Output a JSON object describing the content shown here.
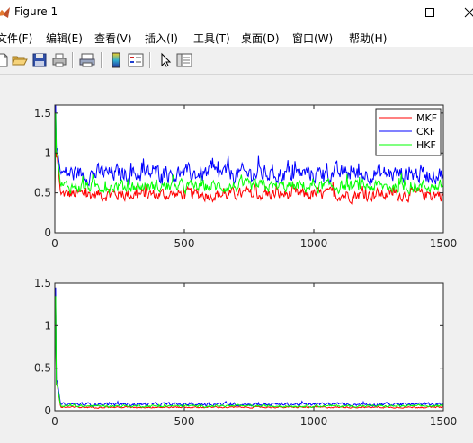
{
  "window": {
    "title": "Figure 1"
  },
  "menu": [
    {
      "label": "文件(F)"
    },
    {
      "label": "编辑(E)"
    },
    {
      "label": "查看(V)"
    },
    {
      "label": "插入(I)"
    },
    {
      "label": "工具(T)"
    },
    {
      "label": "桌面(D)"
    },
    {
      "label": "窗口(W)"
    },
    {
      "label": "帮助(H)"
    }
  ],
  "toolbar": {
    "icons": [
      "new-figure-icon",
      "open-file-icon",
      "save-icon",
      "print-icon",
      "print-preview-icon",
      "colorbar-icon",
      "legend-icon",
      "edit-plot-arrow-icon",
      "property-editor-icon"
    ]
  },
  "colors": {
    "MKF": "#ff0000",
    "CKF": "#0000ff",
    "HKF": "#00ff00"
  },
  "chart_data": [
    {
      "type": "line",
      "title": "",
      "xlabel": "",
      "ylabel": "",
      "xlim": [
        0,
        1500
      ],
      "ylim": [
        0,
        1.6
      ],
      "xticks": [
        0,
        500,
        1000,
        1500
      ],
      "yticks": [
        0,
        0.5,
        1,
        1.5
      ],
      "legend": "top-right",
      "series": [
        {
          "name": "MKF",
          "color": "#ff0000",
          "start": 1.2,
          "peak": 0.95,
          "level": 0.48,
          "noise": 0.05
        },
        {
          "name": "CKF",
          "color": "#0000ff",
          "start": 1.6,
          "peak": 1.05,
          "level": 0.74,
          "noise": 0.07
        },
        {
          "name": "HKF",
          "color": "#00ff00",
          "start": 1.5,
          "peak": 1.0,
          "level": 0.58,
          "noise": 0.05
        }
      ]
    },
    {
      "type": "line",
      "title": "",
      "xlabel": "",
      "ylabel": "",
      "xlim": [
        0,
        1500
      ],
      "ylim": [
        0,
        1.5
      ],
      "xticks": [
        0,
        500,
        1000,
        1500
      ],
      "yticks": [
        0,
        0.5,
        1,
        1.5
      ],
      "legend": "none",
      "series": [
        {
          "color": "#ff0000",
          "start": 1.35,
          "peak": 0.3,
          "level": 0.04,
          "noise": 0.005
        },
        {
          "color": "#0000ff",
          "start": 1.45,
          "peak": 0.35,
          "level": 0.075,
          "noise": 0.012
        },
        {
          "color": "#00ff00",
          "start": 1.35,
          "peak": 0.3,
          "level": 0.055,
          "noise": 0.008
        }
      ]
    }
  ]
}
